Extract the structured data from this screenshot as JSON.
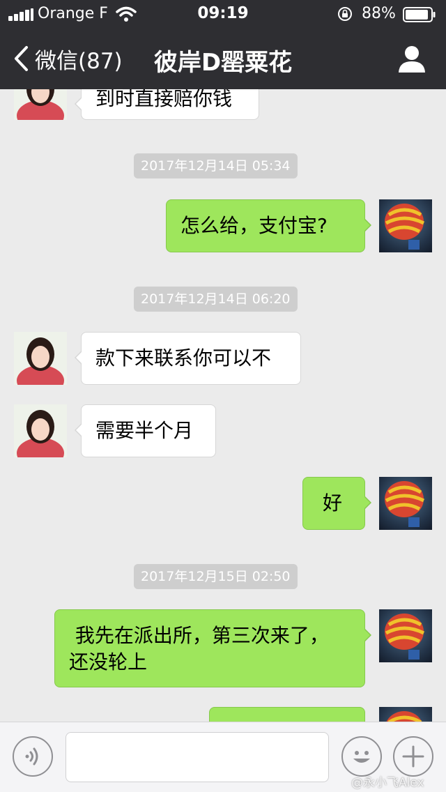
{
  "status_bar": {
    "carrier": "Orange F",
    "time": "09:19",
    "battery": "88%"
  },
  "nav": {
    "back_label": "微信(87)",
    "title": "彼岸D罂粟花"
  },
  "messages": [
    {
      "type": "in",
      "text": "到时直接赔你钱"
    },
    {
      "type": "timestamp",
      "text": "2017年12月14日 05:34"
    },
    {
      "type": "out",
      "text": "怎么给，支付宝?"
    },
    {
      "type": "timestamp",
      "text": "2017年12月14日 06:20"
    },
    {
      "type": "in",
      "text": "款下来联系你可以不"
    },
    {
      "type": "in",
      "text": "需要半个月"
    },
    {
      "type": "out",
      "text": "好"
    },
    {
      "type": "timestamp",
      "text": "2017年12月15日 02:50"
    },
    {
      "type": "out",
      "lines": [
        " 我先在派出所，第三次来了，",
        "还没轮上"
      ]
    },
    {
      "type": "out",
      "text": ""
    }
  ],
  "input_bar": {
    "message_value": "",
    "icons": [
      "voice-icon",
      "emoji-icon",
      "plus-icon"
    ]
  },
  "watermark": "@永小飞Alex",
  "colors": {
    "header_bg": "#2e2e32",
    "chat_bg": "#ebebeb",
    "outgoing_bubble": "#9ee65c",
    "incoming_bubble": "#ffffff",
    "timestamp_bg": "#cecece"
  }
}
